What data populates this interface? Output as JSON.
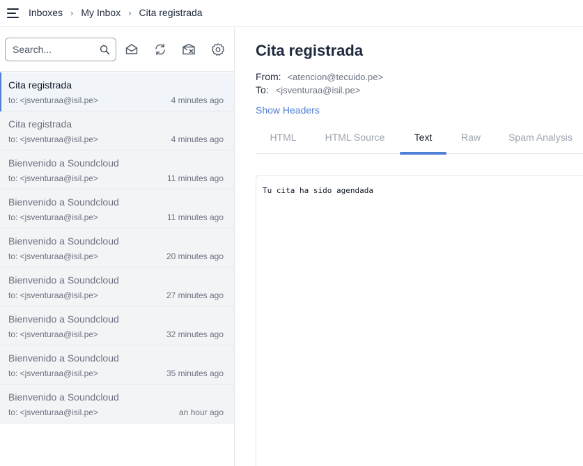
{
  "header": {
    "menu_icon": "hamburger-menu-icon",
    "breadcrumbs": [
      "Inboxes",
      "My Inbox",
      "Cita registrada"
    ],
    "separator": "›"
  },
  "sidebar": {
    "search_placeholder": "Search...",
    "search_value": "",
    "toolbar_icons": [
      "mark-read-icon",
      "refresh-icon",
      "delete-all-icon",
      "settings-icon"
    ],
    "emails": [
      {
        "subject": "Cita registrada",
        "to": "to: <jsventuraa@isil.pe>",
        "time": "4 minutes ago",
        "active": true
      },
      {
        "subject": "Cita registrada",
        "to": "to: <jsventuraa@isil.pe>",
        "time": "4 minutes ago"
      },
      {
        "subject": "Bienvenido a Soundcloud",
        "to": "to: <jsventuraa@isil.pe>",
        "time": "11 minutes ago"
      },
      {
        "subject": "Bienvenido a Soundcloud",
        "to": "to: <jsventuraa@isil.pe>",
        "time": "11 minutes ago"
      },
      {
        "subject": "Bienvenido a Soundcloud",
        "to": "to: <jsventuraa@isil.pe>",
        "time": "20 minutes ago"
      },
      {
        "subject": "Bienvenido a Soundcloud",
        "to": "to: <jsventuraa@isil.pe>",
        "time": "27 minutes ago"
      },
      {
        "subject": "Bienvenido a Soundcloud",
        "to": "to: <jsventuraa@isil.pe>",
        "time": "32 minutes ago"
      },
      {
        "subject": "Bienvenido a Soundcloud",
        "to": "to: <jsventuraa@isil.pe>",
        "time": "35 minutes ago"
      },
      {
        "subject": "Bienvenido a Soundcloud",
        "to": "to: <jsventuraa@isil.pe>",
        "time": "an hour ago"
      }
    ]
  },
  "message": {
    "subject": "Cita registrada",
    "from_label": "From:",
    "from_value": "<atencion@tecuido.pe>",
    "to_label": "To:",
    "to_value": "<jsventuraa@isil.pe>",
    "show_headers": "Show Headers",
    "tabs": [
      "HTML",
      "HTML Source",
      "Text",
      "Raw",
      "Spam Analysis"
    ],
    "active_tab": "Text",
    "body_text": "Tu cita ha sido agendada"
  },
  "colors": {
    "accent": "#4f7fd6",
    "text_dark": "#1e293b",
    "muted": "#6b7280"
  }
}
